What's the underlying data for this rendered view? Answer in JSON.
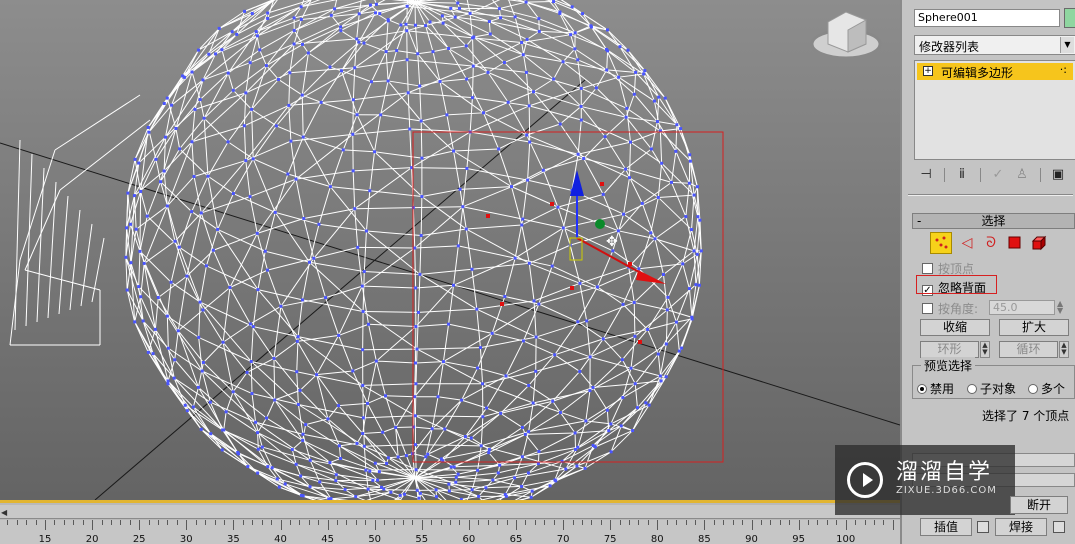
{
  "viewport": {
    "wire_color": "#ffffff",
    "vertex_color": "#4a55ff",
    "selected_vertex_color": "#e01010",
    "selection_rect_color": "#d62020"
  },
  "timeline": {
    "accent": "#e2b531",
    "ticks": [
      "15",
      "20",
      "25",
      "30",
      "35",
      "40",
      "45",
      "50",
      "55",
      "60",
      "65",
      "70",
      "75",
      "80",
      "85",
      "90",
      "95",
      "100"
    ]
  },
  "panel": {
    "object_name": "Sphere001",
    "object_color": "#8fd6a0",
    "modifier_list": "修改器列表",
    "stack_item": "可编辑多边形",
    "stack_item_color": "#f6c51c",
    "tools": [
      "pin-stack-icon",
      "show-end-result-icon",
      "make-unique-icon",
      "remove-modifier-icon",
      "configure-sets-icon"
    ],
    "rollout_title": "选择",
    "subobject_modes": [
      "vertex-icon",
      "edge-icon",
      "border-icon",
      "polygon-icon",
      "element-icon"
    ],
    "by_vertex": "按顶点",
    "ignore_backfacing": "忽略背面",
    "by_angle": "按角度:",
    "angle_value": "45.0",
    "shrink": "收缩",
    "grow": "扩大",
    "ring": "环形",
    "loop": "循环",
    "preview_title": "预览选择",
    "preview_options": [
      "禁用",
      "子对象",
      "多个"
    ],
    "status": "选择了 7 个顶点",
    "break": "断开",
    "bottom_left": "插值",
    "bottom_right": "焊接"
  },
  "watermark": {
    "title": "溜溜自学",
    "subtitle": "ZIXUE.3D66.COM"
  }
}
